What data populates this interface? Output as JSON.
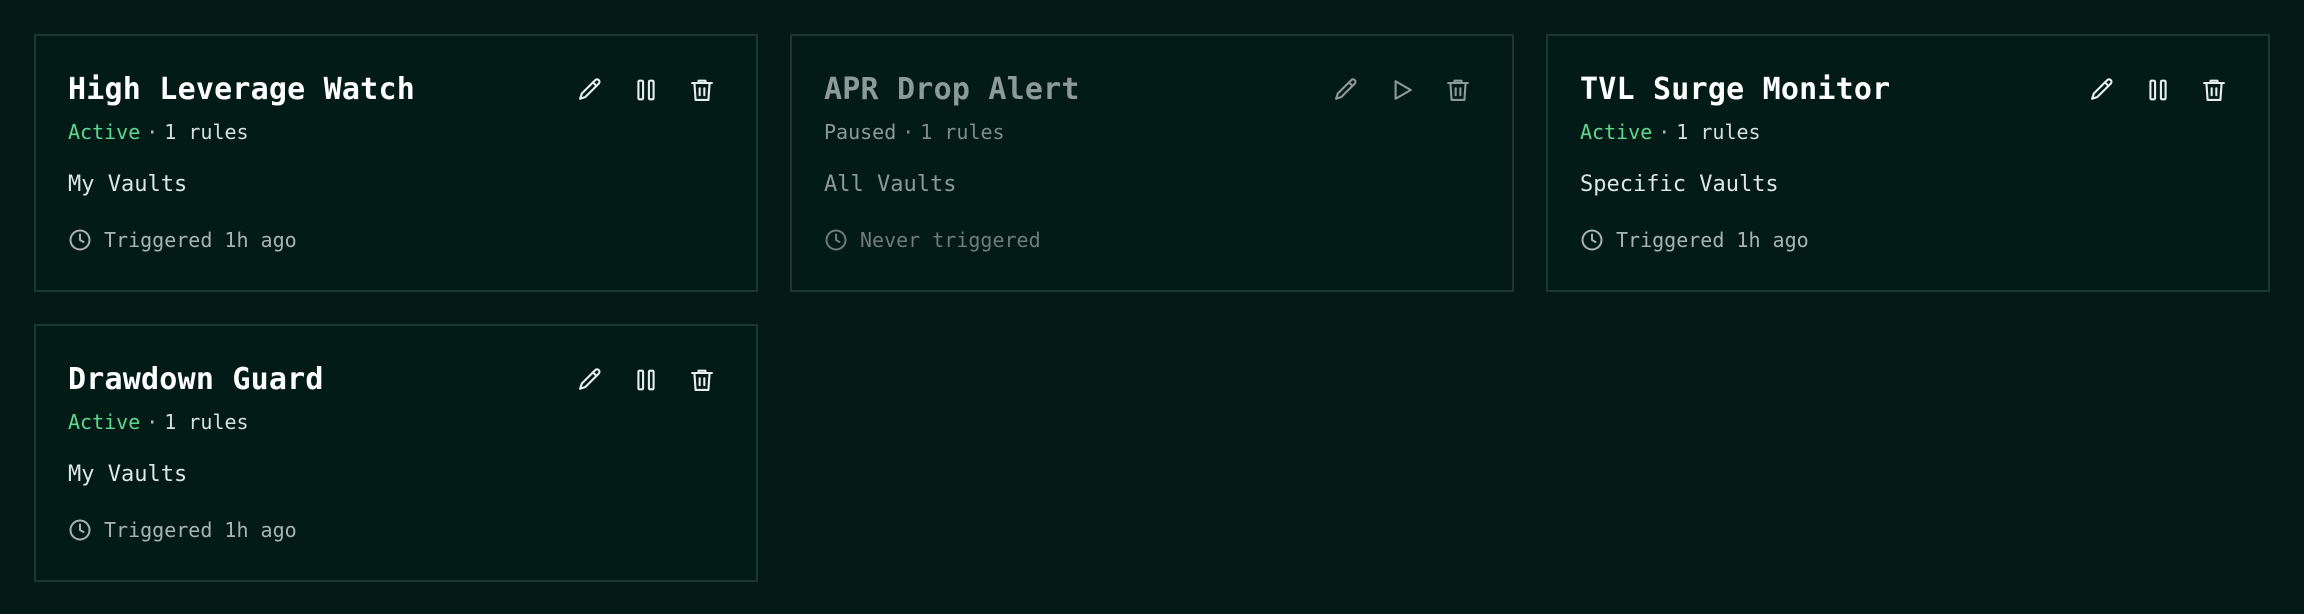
{
  "alerts": [
    {
      "title": "High Leverage Watch",
      "status": "Active",
      "separator": "·",
      "rules": "1 rules",
      "scope": "My Vaults",
      "trigger": "Triggered 1h ago",
      "toggle_icon": "pause-icon",
      "paused": false
    },
    {
      "title": "APR Drop Alert",
      "status": "Paused",
      "separator": "·",
      "rules": "1 rules",
      "scope": "All Vaults",
      "trigger": "Never triggered",
      "toggle_icon": "play-icon",
      "paused": true
    },
    {
      "title": "TVL Surge Monitor",
      "status": "Active",
      "separator": "·",
      "rules": "1 rules",
      "scope": "Specific Vaults",
      "trigger": "Triggered 1h ago",
      "toggle_icon": "pause-icon",
      "paused": false
    },
    {
      "title": "Drawdown Guard",
      "status": "Active",
      "separator": "·",
      "rules": "1 rules",
      "scope": "My Vaults",
      "trigger": "Triggered 1h ago",
      "toggle_icon": "pause-icon",
      "paused": false
    }
  ],
  "icons": {
    "edit": "pencil-icon",
    "delete": "trash-icon",
    "clock": "clock-icon"
  },
  "colors": {
    "background": "#031a17",
    "card_border": "#1d3833",
    "active": "#5fd990",
    "paused": "#8d9a97"
  }
}
